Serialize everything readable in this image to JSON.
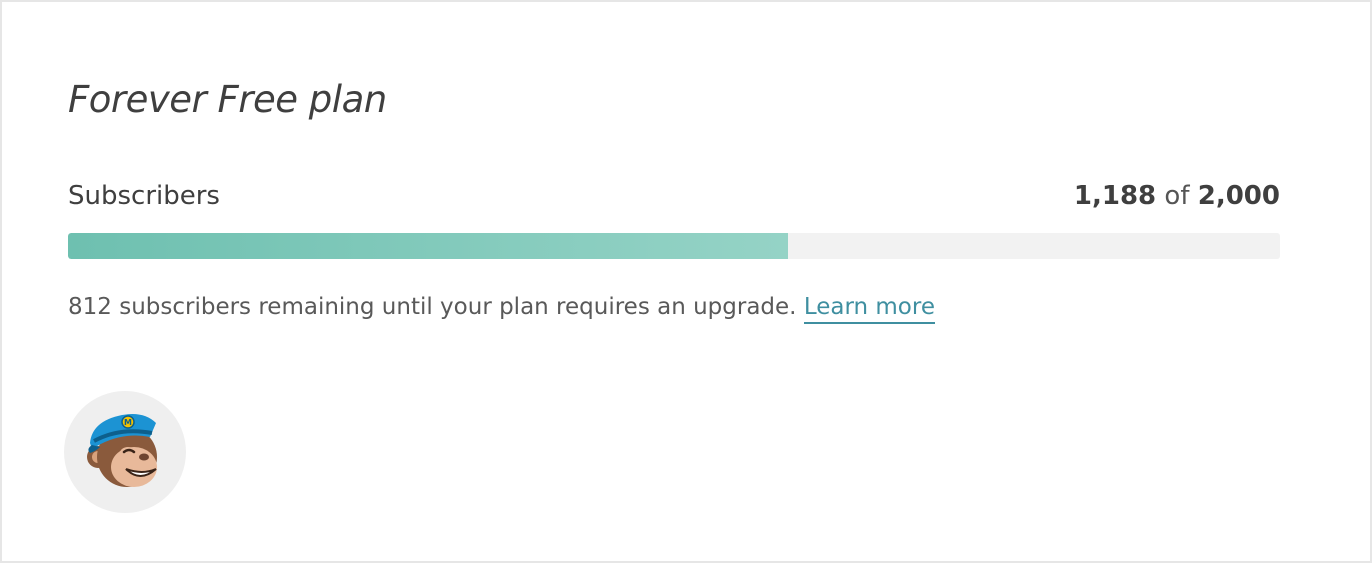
{
  "plan": {
    "title": "Forever Free plan"
  },
  "usage": {
    "label": "Subscribers",
    "used": "1,188",
    "of_word": "of",
    "limit": "2,000",
    "fill_fraction": 0.594,
    "accent_color": "#7cc7b8",
    "track_color": "#f2f2f2"
  },
  "remaining": {
    "message": "812 subscribers remaining until your plan requires an upgrade.",
    "link_label": "Learn more",
    "link_color": "#3f8fa0"
  },
  "avatar": {
    "icon": "mailchimp-freddie-icon"
  }
}
